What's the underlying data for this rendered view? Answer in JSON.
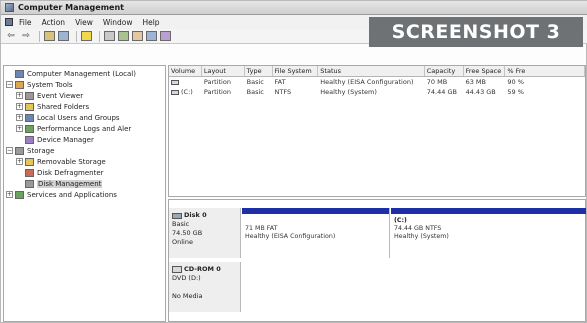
{
  "window": {
    "title": "Computer Management"
  },
  "banner": {
    "text": "SCREENSHOT 3"
  },
  "menu": [
    "File",
    "Action",
    "View",
    "Window",
    "Help"
  ],
  "toolbar": {
    "back": "⇦",
    "forward": "⇨"
  },
  "tree": [
    {
      "label": "Computer Management (Local)",
      "indent": 0,
      "expander": "",
      "icon": "blue"
    },
    {
      "label": "System Tools",
      "indent": 1,
      "expander": "−",
      "icon": "orange"
    },
    {
      "label": "Event Viewer",
      "indent": 2,
      "expander": "+",
      "icon": "gray"
    },
    {
      "label": "Shared Folders",
      "indent": 2,
      "expander": "+",
      "icon": "yellow"
    },
    {
      "label": "Local Users and Groups",
      "indent": 2,
      "expander": "+",
      "icon": "blue"
    },
    {
      "label": "Performance Logs and Aler",
      "indent": 2,
      "expander": "+",
      "icon": "green"
    },
    {
      "label": "Device Manager",
      "indent": 2,
      "expander": "",
      "icon": "purple"
    },
    {
      "label": "Storage",
      "indent": 1,
      "expander": "−",
      "icon": "gray"
    },
    {
      "label": "Removable Storage",
      "indent": 2,
      "expander": "+",
      "icon": "yellow"
    },
    {
      "label": "Disk Defragmenter",
      "indent": 2,
      "expander": "",
      "icon": "red"
    },
    {
      "label": "Disk Management",
      "indent": 2,
      "expander": "",
      "icon": "gray",
      "selected": true
    },
    {
      "label": "Services and Applications",
      "indent": 1,
      "expander": "+",
      "icon": "green"
    }
  ],
  "list": {
    "headers": [
      "Volume",
      "Layout",
      "Type",
      "File System",
      "Status",
      "Capacity",
      "Free Space",
      "% Fre"
    ],
    "rows": [
      {
        "volume": "",
        "layout": "Partition",
        "type": "Basic",
        "fs": "FAT",
        "status": "Healthy (EISA Configuration)",
        "capacity": "70 MB",
        "free": "63 MB",
        "pct": "90 %"
      },
      {
        "volume": "(C:)",
        "layout": "Partition",
        "type": "Basic",
        "fs": "NTFS",
        "status": "Healthy (System)",
        "capacity": "74.44 GB",
        "free": "44.43 GB",
        "pct": "59 %"
      }
    ]
  },
  "disks": [
    {
      "name": "Disk 0",
      "type": "Basic",
      "size": "74.50 GB",
      "state": "Online",
      "partitions": [
        {
          "name": "",
          "line1": "71 MB FAT",
          "line2": "Healthy (EISA Configuration)"
        },
        {
          "name": "(C:)",
          "line1": "74.44 GB NTFS",
          "line2": "Healthy (System)"
        }
      ]
    },
    {
      "name": "CD-ROM 0",
      "type": "DVD (D:)",
      "size": "",
      "state": "No Media",
      "partitions": []
    }
  ],
  "colors": {
    "partition_bar": "#1c2fa6",
    "banner_bg": "#6f7275"
  }
}
